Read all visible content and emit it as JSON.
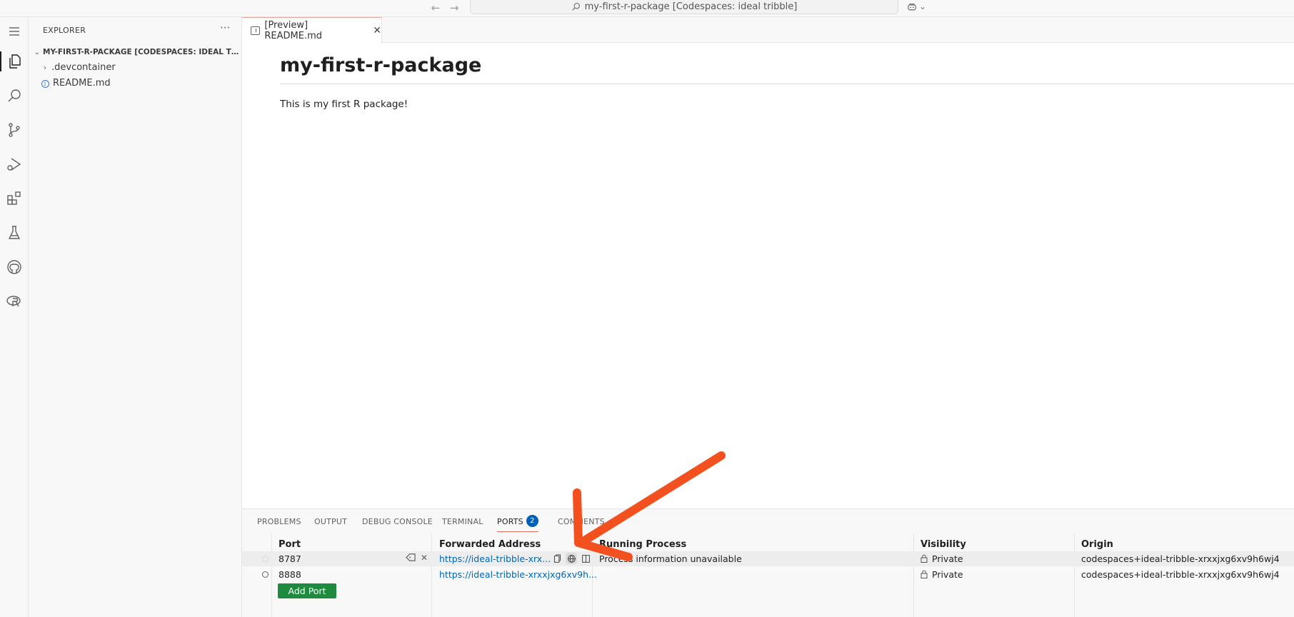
{
  "titlebar": {
    "search_text": "my-first-r-package [Codespaces: ideal tribble]",
    "back_icon": "arrow-left-icon",
    "forward_icon": "arrow-right-icon"
  },
  "activitybar": {
    "items": [
      "menu-icon",
      "explorer-icon",
      "search-icon",
      "source-control-icon",
      "run-debug-icon",
      "extensions-icon",
      "testing-icon",
      "github-icon",
      "r-icon"
    ]
  },
  "sidebar": {
    "title": "EXPLORER",
    "more": "···",
    "folder_title": "MY-FIRST-R-PACKAGE [CODESPACES: IDEAL TRIBBLE]",
    "items": [
      {
        "label": ".devcontainer",
        "type": "folder"
      },
      {
        "label": "README.md",
        "type": "file"
      }
    ]
  },
  "editor": {
    "tab_label": "[Preview] README.md",
    "heading": "my-first-r-package",
    "paragraph": "This is my first R package!"
  },
  "panel": {
    "tabs": [
      "PROBLEMS",
      "OUTPUT",
      "DEBUG CONSOLE",
      "TERMINAL",
      "PORTS",
      "COMMENTS"
    ],
    "ports_badge": "2",
    "columns": [
      "Port",
      "Forwarded Address",
      "Running Process",
      "Visibility",
      "Origin"
    ],
    "rows": [
      {
        "port": "8787",
        "address": "https://ideal-tribble-xrx...",
        "process": "Process information unavailable",
        "visibility": "Private",
        "origin": "codespaces+ideal-tribble-xrxxjxg6xv9h6wj4"
      },
      {
        "port": "8888",
        "address": "https://ideal-tribble-xrxxjxg6xv9h...",
        "process": "",
        "visibility": "Private",
        "origin": "codespaces+ideal-tribble-xrxxjxg6xv9h6wj4"
      }
    ],
    "add_port_label": "Add Port"
  },
  "colors": {
    "accent": "#005fb8",
    "add_port_button": "#1e8a3d",
    "link": "#0066b8",
    "annotation_arrow": "#f2501e"
  }
}
